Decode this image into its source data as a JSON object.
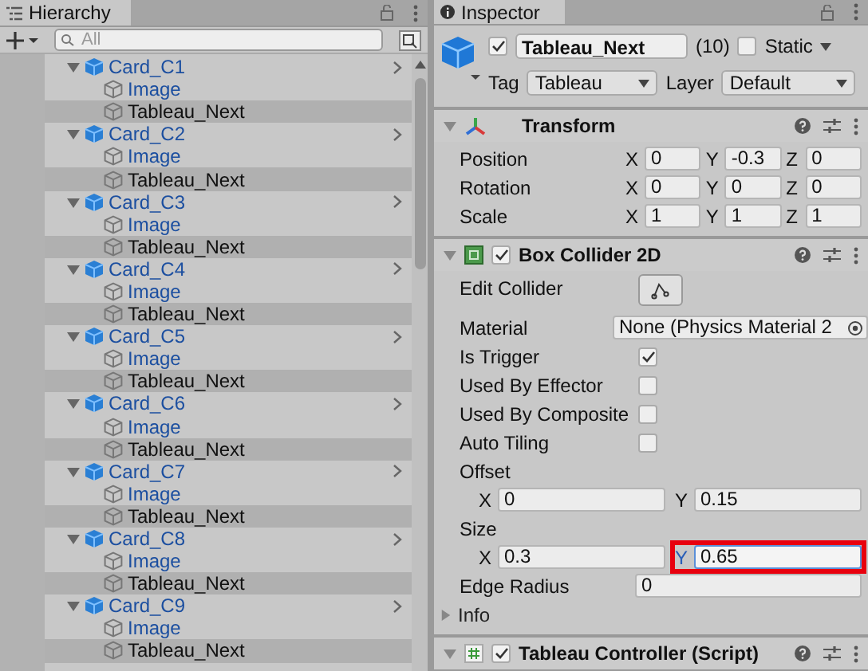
{
  "hierarchy": {
    "title": "Hierarchy",
    "search": {
      "placeholder": "All"
    },
    "items": [
      {
        "name": "Card_C1",
        "kind": "prefab_root",
        "expanded": true,
        "selected": false,
        "children": [
          {
            "name": "Image",
            "kind": "prefab_child",
            "selected": false
          },
          {
            "name": "Tableau_Next",
            "kind": "object",
            "selected": true
          }
        ]
      },
      {
        "name": "Card_C2",
        "kind": "prefab_root",
        "expanded": true,
        "selected": false,
        "children": [
          {
            "name": "Image",
            "kind": "prefab_child",
            "selected": false
          },
          {
            "name": "Tableau_Next",
            "kind": "object",
            "selected": true
          }
        ]
      },
      {
        "name": "Card_C3",
        "kind": "prefab_root",
        "expanded": true,
        "selected": false,
        "children": [
          {
            "name": "Image",
            "kind": "prefab_child",
            "selected": false
          },
          {
            "name": "Tableau_Next",
            "kind": "object",
            "selected": true
          }
        ]
      },
      {
        "name": "Card_C4",
        "kind": "prefab_root",
        "expanded": true,
        "selected": false,
        "children": [
          {
            "name": "Image",
            "kind": "prefab_child",
            "selected": false
          },
          {
            "name": "Tableau_Next",
            "kind": "object",
            "selected": true
          }
        ]
      },
      {
        "name": "Card_C5",
        "kind": "prefab_root",
        "expanded": true,
        "selected": false,
        "children": [
          {
            "name": "Image",
            "kind": "prefab_child",
            "selected": false
          },
          {
            "name": "Tableau_Next",
            "kind": "object",
            "selected": true
          }
        ]
      },
      {
        "name": "Card_C6",
        "kind": "prefab_root",
        "expanded": true,
        "selected": false,
        "children": [
          {
            "name": "Image",
            "kind": "prefab_child",
            "selected": false
          },
          {
            "name": "Tableau_Next",
            "kind": "object",
            "selected": true
          }
        ]
      },
      {
        "name": "Card_C7",
        "kind": "prefab_root",
        "expanded": true,
        "selected": false,
        "children": [
          {
            "name": "Image",
            "kind": "prefab_child",
            "selected": false
          },
          {
            "name": "Tableau_Next",
            "kind": "object",
            "selected": true
          }
        ]
      },
      {
        "name": "Card_C8",
        "kind": "prefab_root",
        "expanded": true,
        "selected": false,
        "children": [
          {
            "name": "Image",
            "kind": "prefab_child",
            "selected": false
          },
          {
            "name": "Tableau_Next",
            "kind": "object",
            "selected": true
          }
        ]
      },
      {
        "name": "Card_C9",
        "kind": "prefab_root",
        "expanded": true,
        "selected": false,
        "children": [
          {
            "name": "Image",
            "kind": "prefab_child",
            "selected": false
          },
          {
            "name": "Tableau_Next",
            "kind": "object",
            "selected": true
          }
        ]
      }
    ]
  },
  "inspector": {
    "title": "Inspector",
    "object": {
      "active": true,
      "name": "Tableau_Next",
      "layer_index": "(10)",
      "static": false,
      "static_label": "Static",
      "tag_label": "Tag",
      "tag": "Tableau",
      "layer_label": "Layer",
      "layer": "Default"
    },
    "components": [
      {
        "kind": "transform",
        "title": "Transform",
        "expanded": true,
        "properties": [
          {
            "kind": "vector3",
            "label": "Position",
            "fields": [
              {
                "axis": "X",
                "value": "0"
              },
              {
                "axis": "Y",
                "value": "-0.3"
              },
              {
                "axis": "Z",
                "value": "0"
              }
            ]
          },
          {
            "kind": "vector3",
            "label": "Rotation",
            "fields": [
              {
                "axis": "X",
                "value": "0"
              },
              {
                "axis": "Y",
                "value": "0"
              },
              {
                "axis": "Z",
                "value": "0"
              }
            ]
          },
          {
            "kind": "vector3",
            "label": "Scale",
            "fields": [
              {
                "axis": "X",
                "value": "1"
              },
              {
                "axis": "Y",
                "value": "1"
              },
              {
                "axis": "Z",
                "value": "1"
              }
            ]
          }
        ]
      },
      {
        "kind": "collider",
        "title": "Box Collider 2D",
        "enabled": true,
        "expanded": true,
        "properties": [
          {
            "kind": "button",
            "label": "Edit Collider"
          },
          {
            "kind": "object",
            "label": "Material",
            "value": "None (Physics Material 2"
          },
          {
            "kind": "checkbox",
            "label": "Is Trigger",
            "checked": true
          },
          {
            "kind": "checkbox",
            "label": "Used By Effector",
            "checked": false
          },
          {
            "kind": "checkbox",
            "label": "Used By Composite",
            "checked": false
          },
          {
            "kind": "checkbox",
            "label": "Auto Tiling",
            "checked": false
          },
          {
            "kind": "vector2",
            "label": "Offset",
            "fields": [
              {
                "axis": "X",
                "value": "0",
                "highlighted": false
              },
              {
                "axis": "Y",
                "value": "0.15",
                "highlighted": false
              }
            ]
          },
          {
            "kind": "vector2",
            "label": "Size",
            "fields": [
              {
                "axis": "X",
                "value": "0.3",
                "highlighted": false
              },
              {
                "axis": "Y",
                "value": "0.65",
                "highlighted": true
              }
            ]
          },
          {
            "kind": "float",
            "label": "Edge Radius",
            "value": "0"
          },
          {
            "kind": "foldout",
            "label": "Info",
            "expanded": false
          }
        ]
      },
      {
        "kind": "script",
        "title": "Tableau Controller (Script)",
        "enabled": true,
        "expanded": true
      }
    ]
  }
}
